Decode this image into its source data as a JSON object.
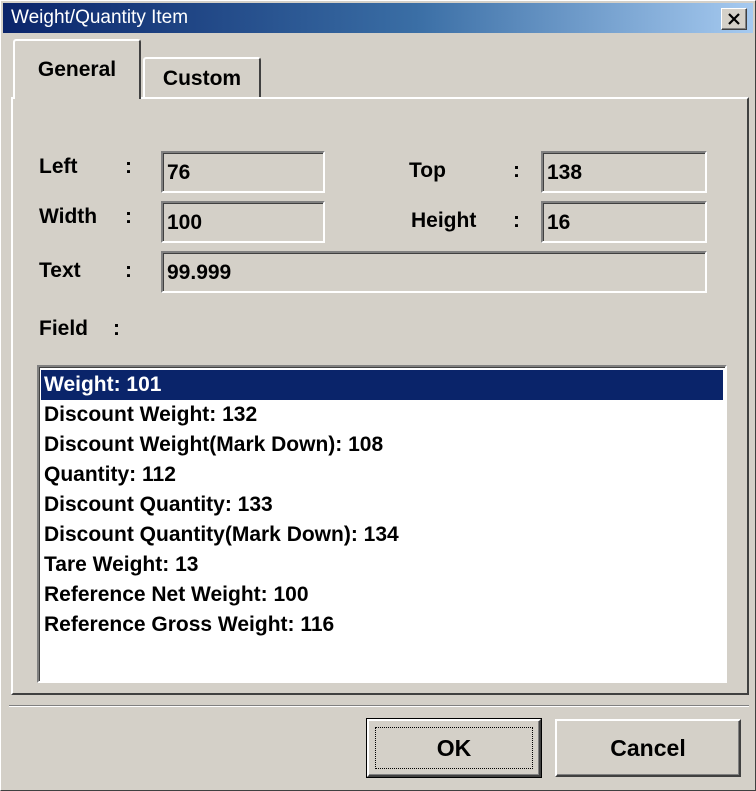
{
  "window": {
    "title": "Weight/Quantity Item",
    "close_icon": "close-icon"
  },
  "tabs": [
    {
      "label": "General",
      "active": true
    },
    {
      "label": "Custom",
      "active": false
    }
  ],
  "fields": {
    "left": {
      "label": "Left",
      "separator": ":",
      "value": "76"
    },
    "top": {
      "label": "Top",
      "separator": ":",
      "value": "138"
    },
    "width": {
      "label": "Width",
      "separator": ":",
      "value": "100"
    },
    "height": {
      "label": "Height",
      "separator": ":",
      "value": "16"
    },
    "text": {
      "label": "Text",
      "separator": ":",
      "value": "99.999"
    }
  },
  "field_list": {
    "label": "Field",
    "separator": ":",
    "selected_index": 0,
    "items": [
      "Weight: 101",
      "Discount Weight: 132",
      "Discount Weight(Mark Down): 108",
      "Quantity: 112",
      "Discount Quantity: 133",
      "Discount Quantity(Mark Down): 134",
      "Tare Weight: 13",
      "Reference Net Weight: 100",
      "Reference Gross Weight: 116"
    ]
  },
  "buttons": {
    "ok": "OK",
    "cancel": "Cancel"
  },
  "colors": {
    "dialog_bg": "#d4d0c8",
    "title_start": "#0a246a",
    "title_end": "#a6caf0",
    "selection_bg": "#0a246a",
    "selection_fg": "#ffffff"
  }
}
